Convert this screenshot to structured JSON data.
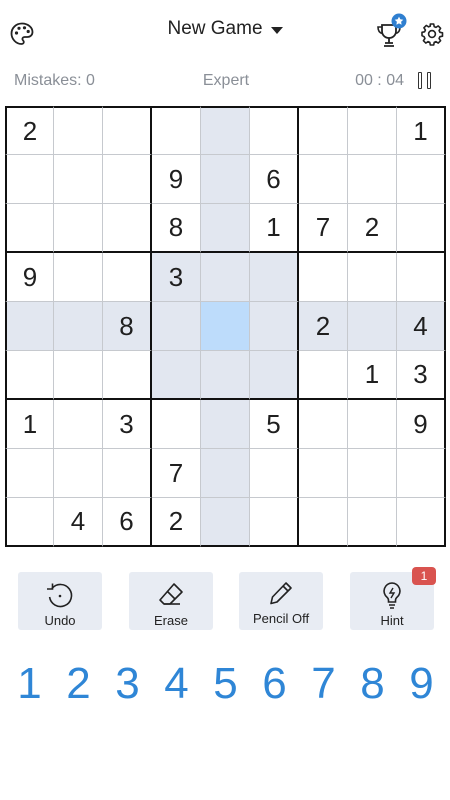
{
  "header": {
    "title": "New Game",
    "hint_badge": "1"
  },
  "status": {
    "mistakes": "Mistakes: 0",
    "difficulty": "Expert",
    "timer": "00 : 04"
  },
  "colors": {
    "accent": "#2f86d6",
    "highlight": "#e2e7f0",
    "selected": "#bddcfb",
    "badge": "#d9534f",
    "tool_bg": "#e8ecf3"
  },
  "icons": {
    "palette": "palette-icon",
    "trophy": "trophy-star-icon",
    "settings": "gear-icon",
    "pause": "pause-icon"
  },
  "board": {
    "selected": [
      4,
      4
    ],
    "highlighted": [
      [
        0,
        4
      ],
      [
        1,
        4
      ],
      [
        2,
        4
      ],
      [
        3,
        3
      ],
      [
        3,
        4
      ],
      [
        3,
        5
      ],
      [
        4,
        0
      ],
      [
        4,
        1
      ],
      [
        4,
        2
      ],
      [
        4,
        3
      ],
      [
        4,
        5
      ],
      [
        4,
        6
      ],
      [
        4,
        7
      ],
      [
        4,
        8
      ],
      [
        5,
        3
      ],
      [
        5,
        4
      ],
      [
        5,
        5
      ],
      [
        6,
        4
      ],
      [
        7,
        4
      ],
      [
        8,
        4
      ]
    ],
    "rows": [
      [
        "2",
        "",
        "",
        "",
        "",
        "",
        "",
        "",
        "1"
      ],
      [
        "",
        "",
        "",
        "9",
        "",
        "6",
        "",
        "",
        ""
      ],
      [
        "",
        "",
        "",
        "8",
        "",
        "1",
        "7",
        "2",
        ""
      ],
      [
        "9",
        "",
        "",
        "3",
        "",
        "",
        "",
        "",
        ""
      ],
      [
        "",
        "",
        "8",
        "",
        "",
        "",
        "2",
        "",
        "4"
      ],
      [
        "",
        "",
        "",
        "",
        "",
        "",
        "",
        "1",
        "3"
      ],
      [
        "1",
        "",
        "3",
        "",
        "",
        "5",
        "",
        "",
        "9"
      ],
      [
        "",
        "",
        "",
        "7",
        "",
        "",
        "",
        "",
        ""
      ],
      [
        "",
        "4",
        "6",
        "2",
        "",
        "",
        "",
        "",
        ""
      ]
    ]
  },
  "tools": [
    {
      "id": "undo",
      "label": "Undo",
      "icon": "undo-icon"
    },
    {
      "id": "erase",
      "label": "Erase",
      "icon": "eraser-icon"
    },
    {
      "id": "pencil",
      "label": "Pencil Off",
      "icon": "pencil-icon"
    },
    {
      "id": "hint",
      "label": "Hint",
      "icon": "lightbulb-icon"
    }
  ],
  "numpad": [
    "1",
    "2",
    "3",
    "4",
    "5",
    "6",
    "7",
    "8",
    "9"
  ]
}
